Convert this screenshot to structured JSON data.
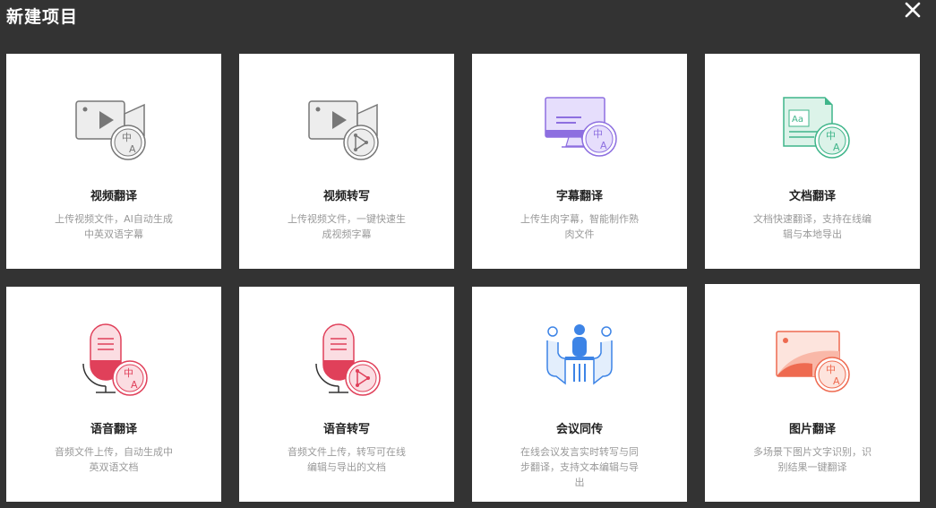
{
  "dialog": {
    "title": "新建项目"
  },
  "cards": [
    {
      "name": "视频翻译",
      "desc": "上传视频文件，AI自动生成中英双语字幕",
      "icon": "video-translate-icon"
    },
    {
      "name": "视频转写",
      "desc": "上传视频文件，一键快速生成视频字幕",
      "icon": "video-transcribe-icon"
    },
    {
      "name": "字幕翻译",
      "desc": "上传生肉字幕，智能制作熟肉文件",
      "icon": "subtitle-translate-icon"
    },
    {
      "name": "文档翻译",
      "desc": "文档快速翻译，支持在线编辑与本地导出",
      "icon": "document-translate-icon"
    },
    {
      "name": "语音翻译",
      "desc": "音频文件上传，自动生成中英双语文档",
      "icon": "audio-translate-icon"
    },
    {
      "name": "语音转写",
      "desc": "音频文件上传，转写可在线编辑与导出的文档",
      "icon": "audio-transcribe-icon"
    },
    {
      "name": "会议同传",
      "desc": "在线会议发言实时转写与同步翻译，支持文本编辑与导出",
      "icon": "meeting-interpret-icon"
    },
    {
      "name": "图片翻译",
      "desc": "多场景下图片文字识别，识别结果一键翻译",
      "icon": "image-translate-icon"
    }
  ],
  "icon_glyphs": {
    "zh": "中",
    "a": "A",
    "aa": "Aa"
  },
  "colors": {
    "background": "#333333",
    "card": "#ffffff",
    "gray_icon": "#777777",
    "purple": "#8d6fe0",
    "green": "#3fb58a",
    "red": "#e0405a",
    "blue": "#3d84e6",
    "orange": "#ee6a50"
  }
}
